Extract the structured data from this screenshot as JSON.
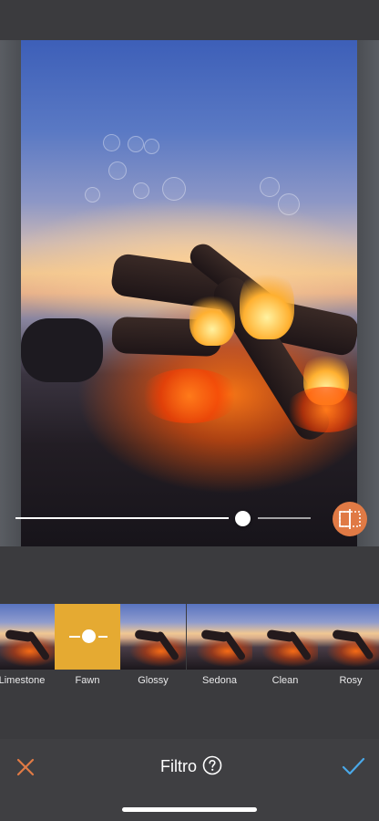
{
  "toolbar": {
    "title": "Filtro",
    "cancel_icon": "close-icon",
    "help_icon": "help-circle-icon",
    "confirm_icon": "checkmark-icon",
    "accent_cancel": "#e07a45",
    "accent_confirm": "#4aa8e8"
  },
  "editor": {
    "intensity": 0.69,
    "compare_icon": "compare-split-icon",
    "compare_color": "#e07a45"
  },
  "filters": {
    "selected": "Fawn",
    "items": [
      {
        "label": "Limestone"
      },
      {
        "label": "Fawn"
      },
      {
        "label": "Glossy"
      },
      {
        "label": "Sedona"
      },
      {
        "label": "Clean"
      },
      {
        "label": "Rosy"
      }
    ]
  }
}
